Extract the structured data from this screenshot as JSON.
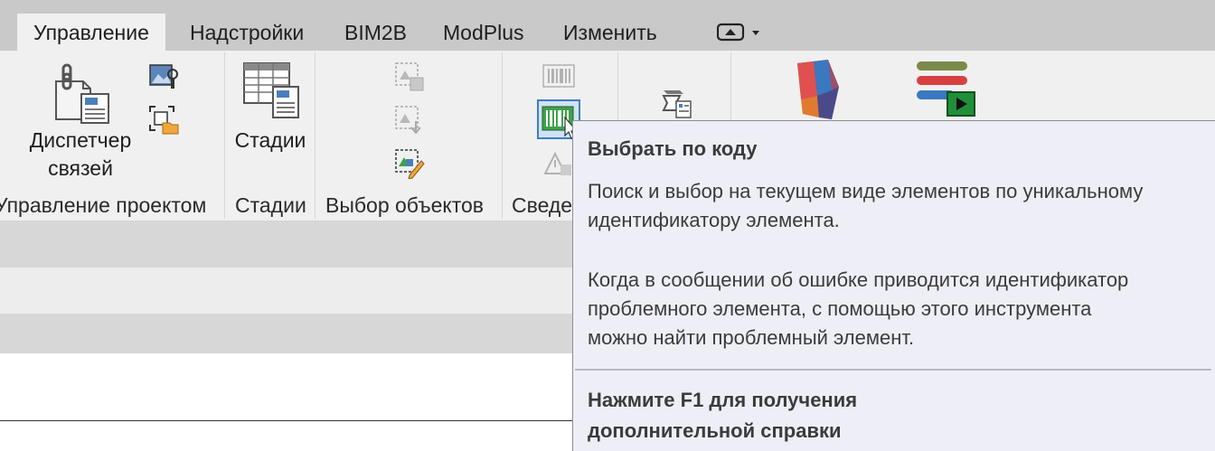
{
  "tabs": [
    {
      "label": "Управление",
      "active": true
    },
    {
      "label": "Надстройки"
    },
    {
      "label": "BIM2B"
    },
    {
      "label": "ModPlus"
    },
    {
      "label": "Изменить"
    }
  ],
  "ribbon": {
    "manage_links_label_line1": "Диспетчер",
    "manage_links_label_line2": "связей",
    "phases_label": "Стадии",
    "panels": {
      "project_management": "Управление проектом",
      "phases": "Стадии",
      "selection": "Выбор объектов",
      "inquiry": "Сведе"
    }
  },
  "tooltip": {
    "title": "Выбрать по коду",
    "description_line1": "Поиск и выбор на текущем виде элементов по уникальному",
    "description_line2": "идентификатору элемента.",
    "details_line1": "Когда в сообщении об ошибке приводится идентификатор",
    "details_line2": "проблемного элемента, с помощью этого инструмента",
    "details_line3": "можно найти проблемный элемент.",
    "help_line1": "Нажмите F1 для получения",
    "help_line2": "дополнительной справки"
  },
  "colors": {
    "tabbar_bg": "#c9c9c9",
    "ribbon_bg": "#f0f0f0",
    "tooltip_bg": "#eeeff6",
    "selected_button_border": "#3c7fc4"
  }
}
